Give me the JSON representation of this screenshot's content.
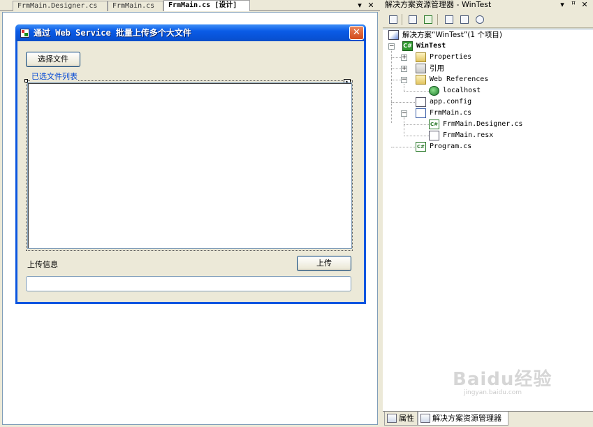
{
  "doc_tabs": [
    {
      "label": "FrmMain.Designer.cs",
      "active": false
    },
    {
      "label": "FrmMain.cs",
      "active": false
    },
    {
      "label": "FrmMain.cs [设计]",
      "active": true
    }
  ],
  "tab_controls": {
    "dropdown": "▾",
    "close": "✕"
  },
  "form": {
    "title": "通过 Web Service 批量上传多个大文件",
    "close_glyph": "✕",
    "select_files_label": "选择文件",
    "list_caption": "已选文件列表",
    "upload_info_label": "上传信息",
    "upload_button_label": "上传",
    "upload_info_value": ""
  },
  "solution_explorer": {
    "title": "解决方案资源管理器 - WinTest",
    "controls": {
      "dropdown": "▾",
      "pin": "ꟸ",
      "close": "✕"
    },
    "tree": [
      {
        "label": "解决方案“WinTest”(1 个项目)",
        "icon": "solution-icon"
      },
      {
        "label": "WinTest",
        "icon": "csharp-project-icon",
        "bold": true
      },
      {
        "label": "Properties",
        "icon": "properties-folder-icon"
      },
      {
        "label": "引用",
        "icon": "references-icon"
      },
      {
        "label": "Web References",
        "icon": "web-references-folder-icon"
      },
      {
        "label": "localhost",
        "icon": "globe-icon"
      },
      {
        "label": "app.config",
        "icon": "config-file-icon"
      },
      {
        "label": "FrmMain.cs",
        "icon": "form-file-icon"
      },
      {
        "label": "FrmMain.Designer.cs",
        "icon": "cs-file-icon"
      },
      {
        "label": "FrmMain.resx",
        "icon": "resx-file-icon"
      },
      {
        "label": "Program.cs",
        "icon": "cs-file-icon"
      }
    ],
    "bottom_tabs": [
      {
        "label": "属性",
        "icon": "properties-window-icon"
      },
      {
        "label": "解决方案资源管理器",
        "icon": "solution-explorer-icon"
      }
    ]
  },
  "watermark": {
    "text": "Baidu经验",
    "sub": "jingyan.baidu.com"
  },
  "colors": {
    "xp_title_blue": "#0a55e0",
    "xp_close_red": "#d24a1c",
    "caption_blue": "#0046d5",
    "chrome": "#ece9d8"
  }
}
